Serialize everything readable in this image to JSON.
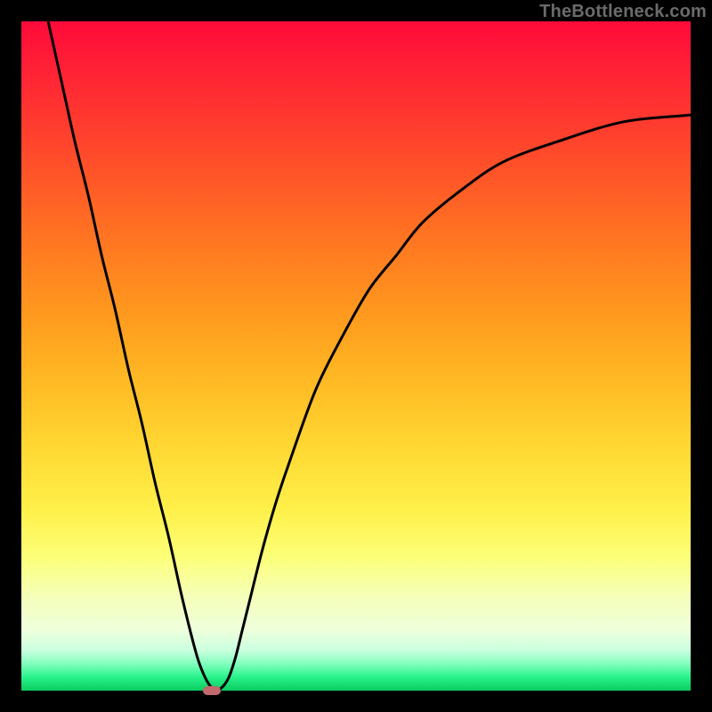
{
  "watermark": "TheBottleneck.com",
  "chart_data": {
    "type": "line",
    "title": "",
    "xlabel": "",
    "ylabel": "",
    "xlim": [
      0,
      100
    ],
    "ylim": [
      0,
      100
    ],
    "series": [
      {
        "name": "bottleneck-curve",
        "x": [
          4,
          6,
          8,
          10,
          12,
          14,
          16,
          18,
          20,
          22,
          24,
          26,
          27,
          28,
          29,
          30,
          31,
          32,
          33,
          34,
          36,
          38,
          40,
          44,
          48,
          52,
          56,
          60,
          66,
          72,
          80,
          90,
          100
        ],
        "y": [
          100,
          91,
          82,
          74,
          65,
          57,
          48,
          40,
          31,
          23,
          14,
          6,
          3,
          1,
          0,
          0.5,
          2,
          5,
          9,
          13,
          21,
          28,
          34,
          45,
          53,
          60,
          65,
          70,
          75,
          79,
          82,
          85,
          86
        ]
      }
    ],
    "marker": {
      "x": 28.5,
      "y": 0
    },
    "legend": false,
    "grid": false
  }
}
